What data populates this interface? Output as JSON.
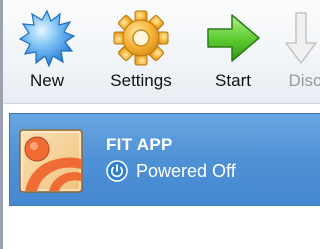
{
  "toolbar": {
    "buttons": [
      {
        "id": "new",
        "label": "New",
        "icon": "new-icon",
        "enabled": true
      },
      {
        "id": "settings",
        "label": "Settings",
        "icon": "gear-icon",
        "enabled": true
      },
      {
        "id": "start",
        "label": "Start",
        "icon": "start-arrow-icon",
        "enabled": true
      },
      {
        "id": "discard",
        "label": "Disc",
        "icon": "discard-icon",
        "enabled": false
      }
    ]
  },
  "vm_list": {
    "items": [
      {
        "name": "FIT APP",
        "state": "Powered Off",
        "state_icon": "power-icon",
        "selected": true
      }
    ]
  },
  "colors": {
    "selection": "#4f91d6",
    "toolbar_bg": "#f1f4f8",
    "new_icon": "#3d96e6",
    "gear_icon": "#f0a81c",
    "start_icon": "#4cbf2a"
  }
}
